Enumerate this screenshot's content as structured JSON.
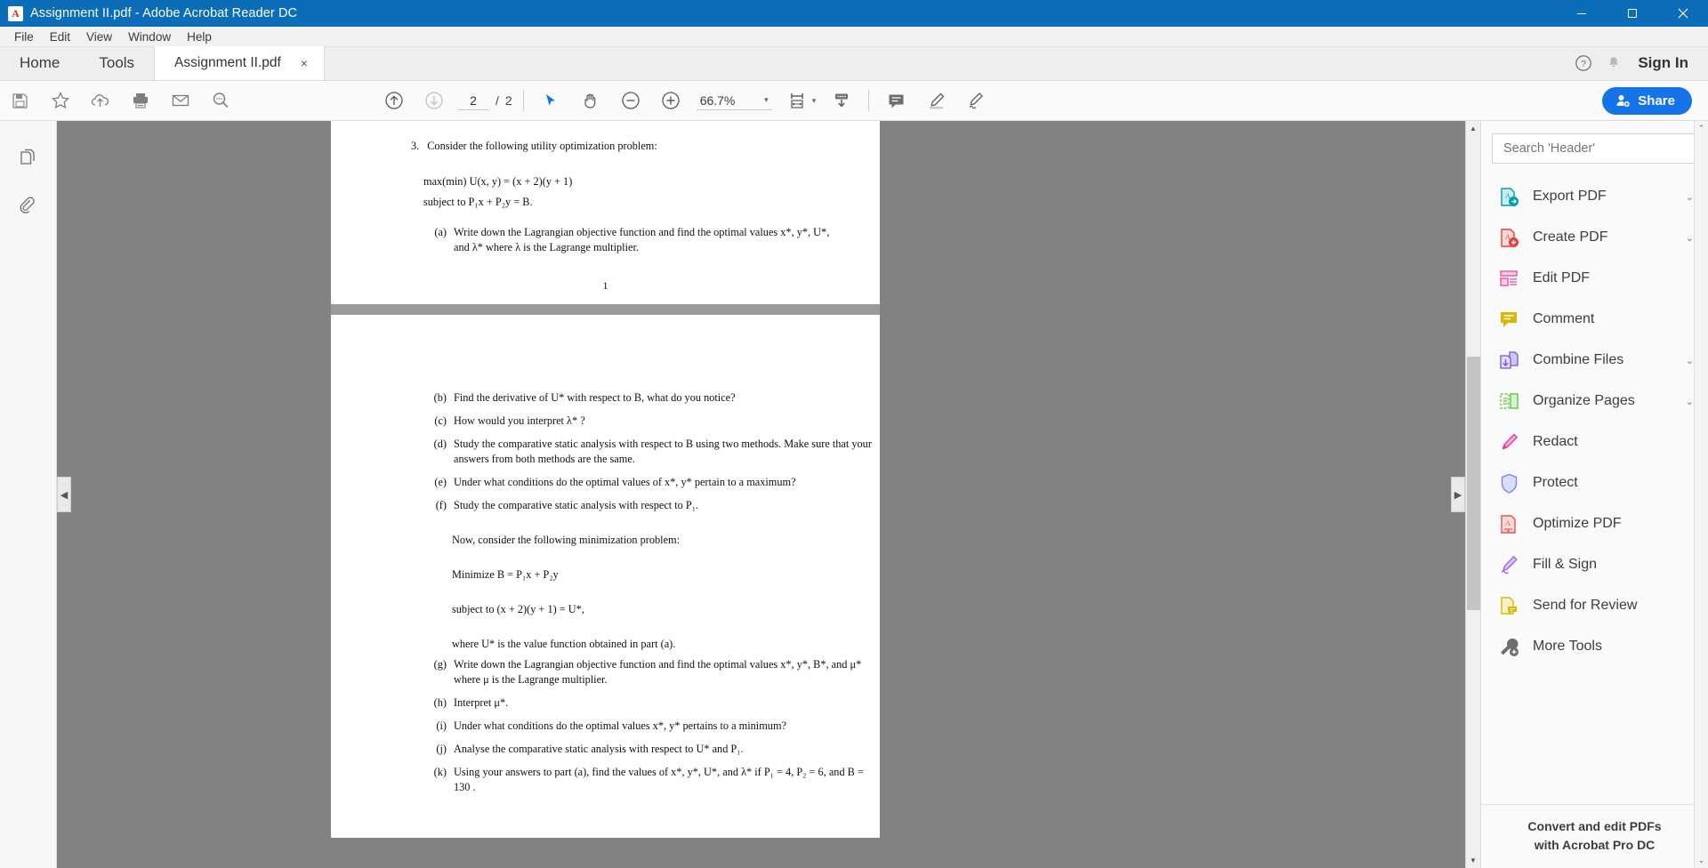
{
  "window": {
    "title": "Assignment II.pdf - Adobe Acrobat Reader DC",
    "app_icon": "pdf-file-icon",
    "minimize": "minimize-icon",
    "maximize": "maximize-icon",
    "close": "close-icon",
    "titlebar_color": "#0b6cb8"
  },
  "menubar": {
    "items": [
      {
        "label": "File"
      },
      {
        "label": "Edit"
      },
      {
        "label": "View"
      },
      {
        "label": "Window"
      },
      {
        "label": "Help"
      }
    ]
  },
  "tabbar": {
    "home": "Home",
    "tools": "Tools",
    "document_tab": "Assignment II.pdf",
    "close_glyph": "×",
    "help_icon": "help-circle-icon",
    "bell_icon": "notification-bell-icon",
    "signin": "Sign In"
  },
  "toolbar": {
    "save_icon": "save-icon",
    "star_icon": "star-icon",
    "cloud_icon": "cloud-upload-icon",
    "print_icon": "print-icon",
    "email_icon": "email-icon",
    "search_icon": "search-icon",
    "prev_page_icon": "page-up-icon",
    "next_page_icon": "page-down-icon",
    "current_page": "2",
    "page_separator": "/",
    "total_pages": "2",
    "select_tool_icon": "select-cursor-icon",
    "hand_tool_icon": "hand-tool-icon",
    "zoom_out_icon": "zoom-out-icon",
    "zoom_in_icon": "zoom-in-icon",
    "zoom_value": "66.7%",
    "zoom_caret": "▾",
    "fit_page_icon": "fit-page-icon",
    "fit_caret": "▾",
    "scroll_mode_icon": "scroll-mode-icon",
    "comment_icon": "comment-icon",
    "highlight_icon": "highlight-pen-icon",
    "signature_icon": "fill-sign-icon",
    "share_label": "Share",
    "share_icon": "add-person-icon",
    "share_color": "#1473e6"
  },
  "leftrail": {
    "thumbnails_icon": "page-thumbnails-icon",
    "attachments_icon": "attachment-paperclip-icon"
  },
  "viewer": {
    "nav_left": "◀",
    "nav_right": "▶",
    "scroll_up": "▲",
    "scroll_down": "▼"
  },
  "document": {
    "page1": {
      "question_number": "3.",
      "question_text": "Consider the following utility optimization problem:",
      "objective": "max(min) U(x, y) = (x + 2)(y + 1)",
      "constraint": "subject to P₁x + P₂y = B.",
      "part_a_label": "(a)",
      "part_a_line1": "Write down the Lagrangian objective function and find the optimal values x*, y*, U*,",
      "part_a_line2": "and λ* where λ is the Lagrange multiplier.",
      "folio": "1"
    },
    "page2": {
      "items": [
        {
          "label": "(b)",
          "text": "Find the derivative of U* with respect to B, what do you notice?"
        },
        {
          "label": "(c)",
          "text": "How would you interpret λ* ?"
        },
        {
          "label": "(d)",
          "text": "Study the comparative static analysis with respect to B using two methods. Make sure that your answers from both methods are the same."
        },
        {
          "label": "(e)",
          "text": "Under what conditions do the optimal values of x*, y* pertain to a maximum?"
        },
        {
          "label": "(f)",
          "text": "Study the comparative static analysis with respect to P₁."
        }
      ],
      "min_intro": "Now, consider the following minimization problem:",
      "min_objective": "Minimize B = P₁x + P₂y",
      "min_constraint": "subject to (x + 2)(y + 1) = U*,",
      "min_where": "where U* is the value function obtained in part (a).",
      "items2": [
        {
          "label": "(g)",
          "text": "Write down the Lagrangian objective function and find the optimal values x*, y*, B*, and μ* where μ is the Lagrange multiplier."
        },
        {
          "label": "(h)",
          "text": "Interpret μ*."
        },
        {
          "label": "(i)",
          "text": "Under what conditions do the optimal values x*, y* pertains to a minimum?"
        },
        {
          "label": "(j)",
          "text": "Analyse the comparative static analysis with respect to U* and P₁."
        },
        {
          "label": "(k)",
          "text": "Using your answers to part (a), find the values of x*, y*, U*, and λ* if P₁ = 4, P₂ = 6, and B = 130 ."
        }
      ]
    }
  },
  "rightpanel": {
    "search_placeholder": "Search 'Header'",
    "tools": [
      {
        "label": "Export PDF",
        "icon": "export-pdf-icon",
        "caret": "⌄",
        "color": "#00a0a8"
      },
      {
        "label": "Create PDF",
        "icon": "create-pdf-icon",
        "caret": "⌄",
        "color": "#e8413c"
      },
      {
        "label": "Edit PDF",
        "icon": "edit-pdf-icon",
        "caret": "",
        "color": "#e8469b"
      },
      {
        "label": "Comment",
        "icon": "comment-tool-icon",
        "caret": "",
        "color": "#dbb800"
      },
      {
        "label": "Combine Files",
        "icon": "combine-files-icon",
        "caret": "⌄",
        "color": "#7b54d6"
      },
      {
        "label": "Organize Pages",
        "icon": "organize-pages-icon",
        "caret": "⌄",
        "color": "#5fc64a"
      },
      {
        "label": "Redact",
        "icon": "redact-icon",
        "caret": "",
        "color": "#e8399b"
      },
      {
        "label": "Protect",
        "icon": "protect-shield-icon",
        "caret": "",
        "color": "#7b83e8"
      },
      {
        "label": "Optimize PDF",
        "icon": "optimize-pdf-icon",
        "caret": "",
        "color": "#e8534c"
      },
      {
        "label": "Fill & Sign",
        "icon": "fill-sign-tool-icon",
        "caret": "",
        "color": "#a35ef0"
      },
      {
        "label": "Send for Review",
        "icon": "send-review-icon",
        "caret": "",
        "color": "#dbb800"
      },
      {
        "label": "More Tools",
        "icon": "more-tools-icon",
        "caret": "",
        "color": "#6e6e6e"
      }
    ],
    "promo_line1": "Convert and edit PDFs",
    "promo_line2": "with Acrobat Pro DC",
    "scroll_up": "⌃",
    "scroll_down": "⌄"
  }
}
